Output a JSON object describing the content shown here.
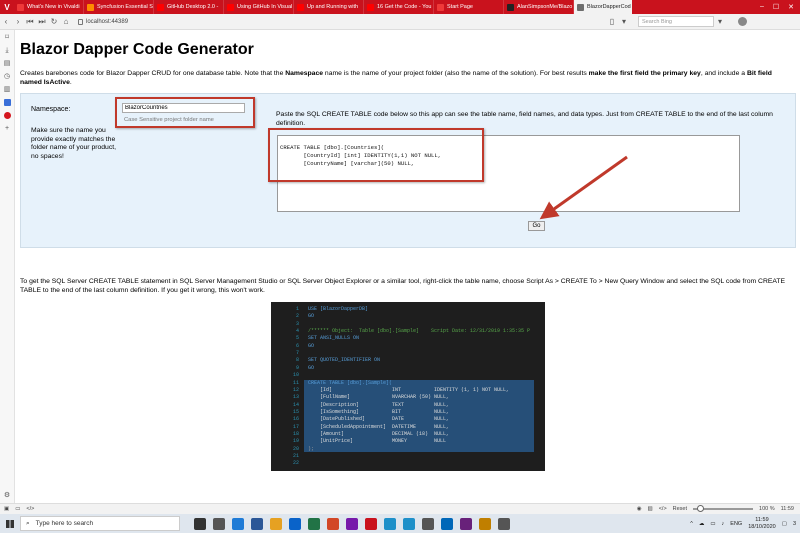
{
  "browser": {
    "tabs": [
      {
        "label": "What's New in Vivaldi",
        "color": "#ef3939"
      },
      {
        "label": "Syncfusion Essential St",
        "color": "#ff8c00"
      },
      {
        "label": "GitHub Desktop 2.0 -",
        "color": "#ff0000"
      },
      {
        "label": "Using GitHub In Visual",
        "color": "#ff0000"
      },
      {
        "label": "Up and Running with",
        "color": "#ff0000"
      },
      {
        "label": "16 Get the Code - You",
        "color": "#ff0000"
      },
      {
        "label": "Start Page",
        "color": "#ef3939"
      },
      {
        "label": "AlanSimpsonMe/Blazo",
        "color": "#222222"
      },
      {
        "label": "BlazorDapperCodeGen",
        "color": "#6d6d6d",
        "active": true
      }
    ],
    "url": "localhost:44389",
    "search_placeholder": "Search Bing"
  },
  "page": {
    "title": "Blazor Dapper Code Generator",
    "intro_part1": "Creates barebones code for Blazor Dapper CRUD for one database table. Note that the ",
    "intro_bold1": "Namespace",
    "intro_part2": " name is the name of your project folder (also the name of the solution). For best results ",
    "intro_bold2": "make the first field the primary key",
    "intro_part3": ", and include a ",
    "intro_bold3": "Bit field named IsActive",
    "intro_part4": ".",
    "namespace_label": "Namespace:",
    "namespace_value": "BlazorCountries",
    "namespace_hint": "Case Sensitive project folder name",
    "namespace_note": "Make sure the name you provide exactly matches the folder name of your product, no spaces!",
    "sql_instructions": "Paste the SQL CREATE TABLE code below so this app can see the table name, field names, and data types. Just from CREATE TABLE to the end of the last column definition.",
    "sql_text": "CREATE TABLE [dbo].[Countries](\n       [CountryId] [int] IDENTITY(1,1) NOT NULL,\n       [CountryName] [varchar](50) NULL,",
    "go_label": "Go",
    "how_to": "To get the SQL Server CREATE TABLE statement in SQL Server Management Studio or SQL Server Object Explorer or a similar tool, right-click the table name, choose Script As > CREATE To > New Query Window and select the SQL code from CREATE TABLE to the end of the last column definition. If you get it wrong, this won't work."
  },
  "code_sample": {
    "lines": [
      {
        "n": "1",
        "t": "USE [BlazorDapperDB]",
        "c": "k"
      },
      {
        "n": "2",
        "t": "GO",
        "c": "k"
      },
      {
        "n": "3",
        "t": "",
        "c": "w"
      },
      {
        "n": "4",
        "t": "/****** Object:  Table [dbo].[Sample]    Script Date: 12/31/2019 1:35:35 P",
        "c": "g"
      },
      {
        "n": "5",
        "t": "SET ANSI_NULLS ON",
        "c": "k"
      },
      {
        "n": "6",
        "t": "GO",
        "c": "k"
      },
      {
        "n": "7",
        "t": "",
        "c": "w"
      },
      {
        "n": "8",
        "t": "SET QUOTED_IDENTIFIER ON",
        "c": "k"
      },
      {
        "n": "9",
        "t": "GO",
        "c": "k"
      },
      {
        "n": "10",
        "t": "",
        "c": "w"
      },
      {
        "n": "11",
        "t": "CREATE TABLE [dbo].[Sample](",
        "c": "k"
      },
      {
        "n": "12",
        "t": "    [Id]                    INT           IDENTITY (1, 1) NOT NULL,",
        "c": "w"
      },
      {
        "n": "13",
        "t": "    [FullName]              NVARCHAR (50) NULL,",
        "c": "w"
      },
      {
        "n": "14",
        "t": "    [Description]           TEXT          NULL,",
        "c": "w"
      },
      {
        "n": "15",
        "t": "    [IsSomething]           BIT           NULL,",
        "c": "w"
      },
      {
        "n": "16",
        "t": "    [DatePublished]         DATE          NULL,",
        "c": "w"
      },
      {
        "n": "17",
        "t": "    [ScheduledAppointment]  DATETIME      NULL,",
        "c": "w"
      },
      {
        "n": "18",
        "t": "    [Amount]                DECIMAL (18)  NULL,",
        "c": "w"
      },
      {
        "n": "19",
        "t": "    [UnitPrice]             MONEY         NULL",
        "c": "w"
      },
      {
        "n": "20",
        "t": ");",
        "c": "gr"
      },
      {
        "n": "21",
        "t": "",
        "c": "w"
      },
      {
        "n": "22",
        "t": "",
        "c": "w"
      }
    ]
  },
  "statusbar": {
    "reset_label": "Reset",
    "zoom": "100 %",
    "time": "11:59"
  },
  "taskbar": {
    "search_placeholder": "Type here to search",
    "lang": "ENG",
    "time": "11:59",
    "date": "18/10/2020",
    "notification_count": "3"
  }
}
